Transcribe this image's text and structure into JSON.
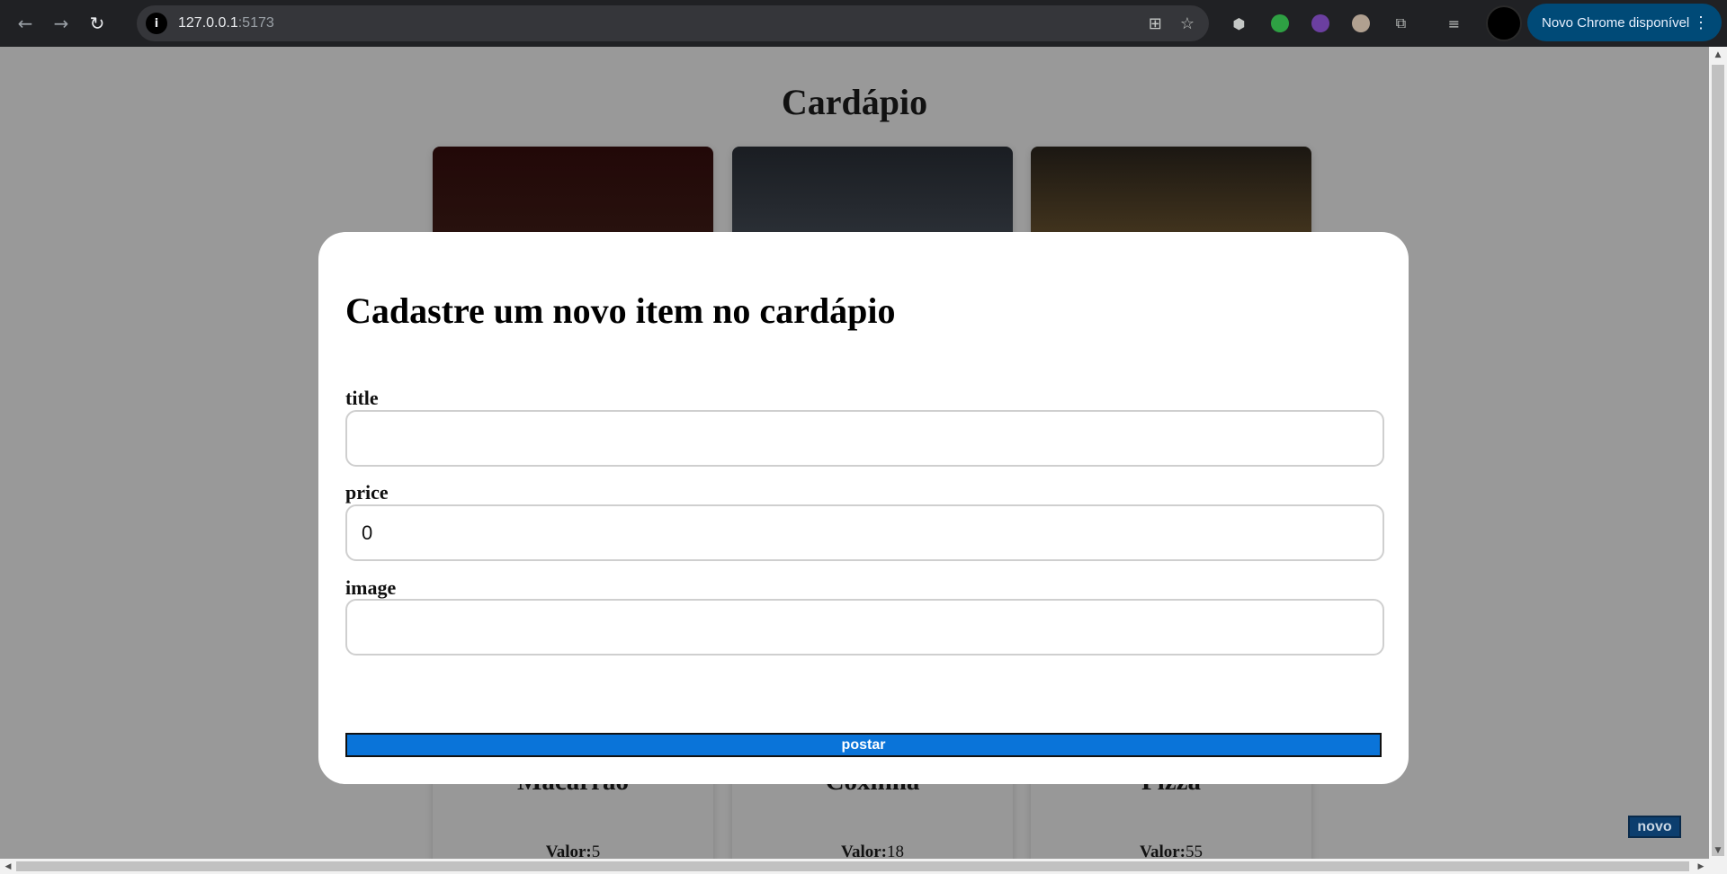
{
  "browser": {
    "url_host": "127.0.0.1",
    "url_port": ":5173",
    "update_label": "Novo Chrome disponível",
    "back_icon": "arrow-left-icon",
    "forward_icon": "arrow-right-icon",
    "reload_icon": "reload-icon"
  },
  "page": {
    "title": "Cardápio",
    "novo_label": "novo",
    "cards": [
      {
        "title": "Macarrão",
        "price_label": "Valor:",
        "price_value": "5"
      },
      {
        "title": "Coxinha",
        "price_label": "Valor:",
        "price_value": "18"
      },
      {
        "title": "Pizza",
        "price_label": "Valor:",
        "price_value": "55"
      }
    ]
  },
  "modal": {
    "title": "Cadastre um novo item no cardápio",
    "fields": [
      {
        "label": "title",
        "value": ""
      },
      {
        "label": "price",
        "value": "0"
      },
      {
        "label": "image",
        "value": ""
      }
    ],
    "submit_label": "postar"
  },
  "colors": {
    "overlay": "#999999",
    "submit_bg": "#0a74d9",
    "update_button": "#004a77"
  }
}
